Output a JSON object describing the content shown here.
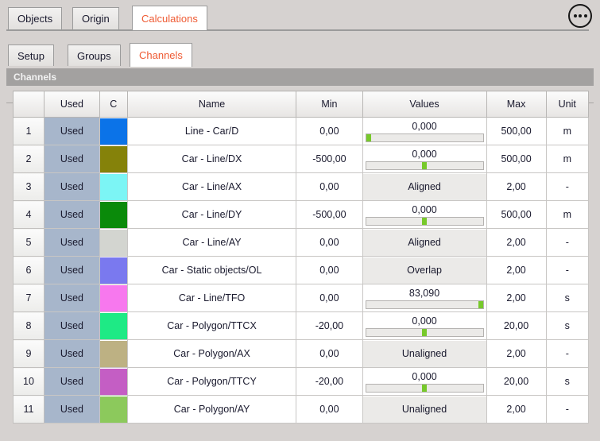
{
  "window": {
    "outer_tabs": [
      {
        "label": "Objects",
        "active": false
      },
      {
        "label": "Origin",
        "active": false
      },
      {
        "label": "Calculations",
        "active": true
      }
    ],
    "sub_tabs": [
      {
        "label": "Setup",
        "active": false
      },
      {
        "label": "Groups",
        "active": false
      },
      {
        "label": "Channels",
        "active": true
      }
    ],
    "overflow_button": "more-options",
    "accent_color": "#ef5b34"
  },
  "section": {
    "title": "Channels"
  },
  "table": {
    "columns": [
      "",
      "Used",
      "C",
      "Name",
      "Min",
      "Values",
      "Max",
      "Unit"
    ],
    "rows": [
      {
        "num": "1",
        "used": "Used",
        "color": "#0b73e8",
        "name": "Line - Car/D",
        "min": "0,00",
        "max": "500,00",
        "unit": "m",
        "value_kind": "slider",
        "value": "0,000",
        "thumb_pct": 0
      },
      {
        "num": "2",
        "used": "Used",
        "color": "#85820a",
        "name": "Car - Line/DX",
        "min": "-500,00",
        "max": "500,00",
        "unit": "m",
        "value_kind": "slider",
        "value": "0,000",
        "thumb_pct": 50
      },
      {
        "num": "3",
        "used": "Used",
        "color": "#7cf5f5",
        "name": "Car - Line/AX",
        "min": "0,00",
        "max": "2,00",
        "unit": "-",
        "value_kind": "text",
        "value": "Aligned"
      },
      {
        "num": "4",
        "used": "Used",
        "color": "#0a8a0a",
        "name": "Car - Line/DY",
        "min": "-500,00",
        "max": "500,00",
        "unit": "m",
        "value_kind": "slider",
        "value": "0,000",
        "thumb_pct": 50
      },
      {
        "num": "5",
        "used": "Used",
        "color": "#d3d5d0",
        "name": "Car - Line/AY",
        "min": "0,00",
        "max": "2,00",
        "unit": "-",
        "value_kind": "text",
        "value": "Aligned"
      },
      {
        "num": "6",
        "used": "Used",
        "color": "#7a79ef",
        "name": "Car - Static objects/OL",
        "min": "0,00",
        "max": "2,00",
        "unit": "-",
        "value_kind": "text",
        "value": "Overlap"
      },
      {
        "num": "7",
        "used": "Used",
        "color": "#f778ee",
        "name": "Car - Line/TFO",
        "min": "0,00",
        "max": "2,00",
        "unit": "s",
        "value_kind": "slider",
        "value": "83,090",
        "thumb_pct": 100
      },
      {
        "num": "8",
        "used": "Used",
        "color": "#1eea85",
        "name": "Car - Polygon/TTCX",
        "min": "-20,00",
        "max": "20,00",
        "unit": "s",
        "value_kind": "slider",
        "value": "0,000",
        "thumb_pct": 50
      },
      {
        "num": "9",
        "used": "Used",
        "color": "#bdb183",
        "name": "Car - Polygon/AX",
        "min": "0,00",
        "max": "2,00",
        "unit": "-",
        "value_kind": "text",
        "value": "Unaligned"
      },
      {
        "num": "10",
        "used": "Used",
        "color": "#c45ec4",
        "name": "Car - Polygon/TTCY",
        "min": "-20,00",
        "max": "20,00",
        "unit": "s",
        "value_kind": "slider",
        "value": "0,000",
        "thumb_pct": 50
      },
      {
        "num": "11",
        "used": "Used",
        "color": "#8cc95c",
        "name": "Car - Polygon/AY",
        "min": "0,00",
        "max": "2,00",
        "unit": "-",
        "value_kind": "text",
        "value": "Unaligned"
      }
    ]
  }
}
